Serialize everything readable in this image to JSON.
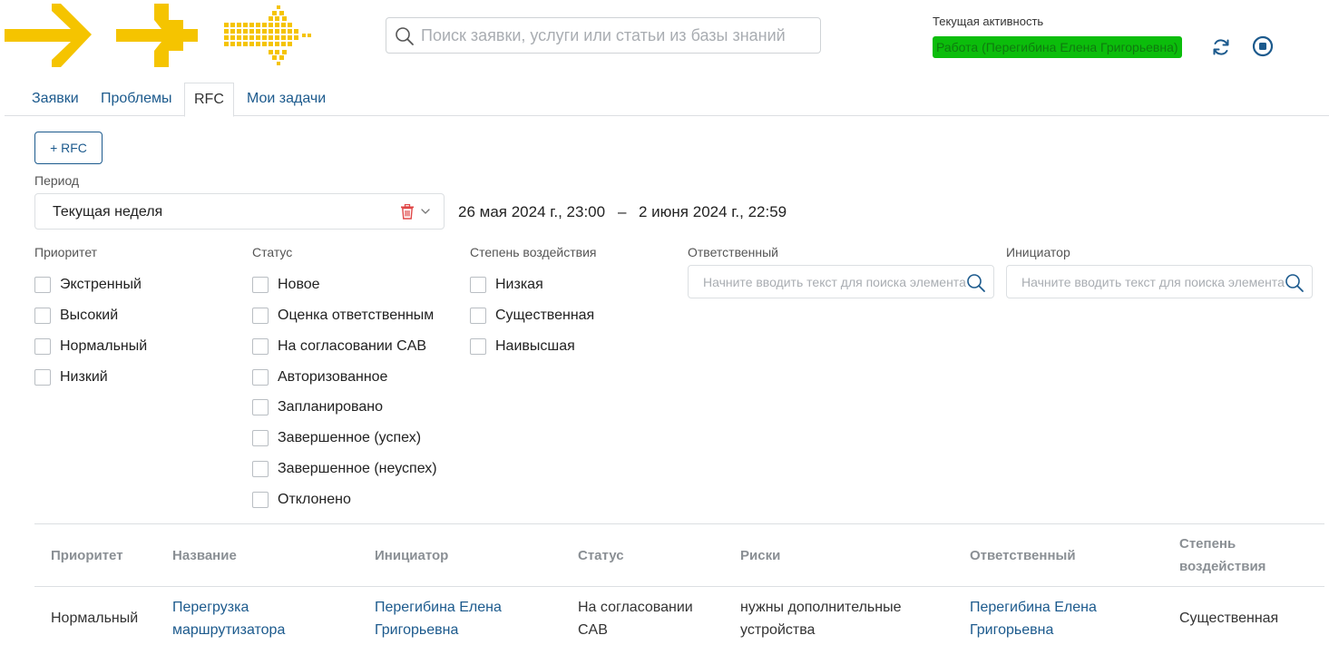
{
  "header": {
    "logo_icons": [
      "arrow-right-icon",
      "arrow-cross-icon",
      "dotted-arrow-icon"
    ],
    "search_placeholder": "Поиск заявки, услуги или статьи из базы знаний",
    "activity_label": "Текущая активность",
    "activity_value": "Работа (Перегибина Елена Григорьевна)",
    "activity_color": "#0bbd0b"
  },
  "tabs": [
    {
      "label": "Заявки"
    },
    {
      "label": "Проблемы"
    },
    {
      "label": "RFC",
      "active": true
    },
    {
      "label": "Мои задачи"
    }
  ],
  "toolbar": {
    "add_label": "+ RFC"
  },
  "period": {
    "label": "Период",
    "value": "Текущая неделя",
    "from": "26 мая 2024 г., 23:00",
    "separator": "–",
    "to": "2 июня 2024 г., 22:59"
  },
  "filters": {
    "priority": {
      "label": "Приоритет",
      "options": [
        "Экстренный",
        "Высокий",
        "Нормальный",
        "Низкий"
      ]
    },
    "status": {
      "label": "Статус",
      "options": [
        "Новое",
        "Оценка ответственным",
        "На согласовании CAB",
        "Авторизованное",
        "Запланировано",
        "Завершенное (успех)",
        "Завершенное (неуспех)",
        "Отклонено"
      ]
    },
    "impact": {
      "label": "Степень воздействия",
      "options": [
        "Низкая",
        "Существенная",
        "Наивысшая"
      ]
    },
    "responsible": {
      "label": "Ответственный",
      "placeholder": "Начните вводить текст для поиска элемента"
    },
    "initiator": {
      "label": "Инициатор",
      "placeholder": "Начните вводить текст для поиска элемента"
    }
  },
  "table": {
    "columns": {
      "priority": "Приоритет",
      "name": "Название",
      "initiator": "Инициатор",
      "status": "Статус",
      "risks": "Риски",
      "responsible": "Ответственный",
      "impact_1": "Степень",
      "impact_2": "воздействия"
    },
    "rows": [
      {
        "priority": "Нормальный",
        "name_1": "Перегрузка",
        "name_2": "маршрутизатора",
        "initiator_1": "Перегибина Елена",
        "initiator_2": "Григорьевна",
        "status_1": "На согласовании",
        "status_2": "CAB",
        "risks_1": "нужны дополнительные",
        "risks_2": "устройства",
        "responsible_1": "Перегибина Елена",
        "responsible_2": "Григорьевна",
        "impact": "Существенная"
      }
    ]
  },
  "colors": {
    "link": "#1c5a8d",
    "logo": "#f5c400",
    "danger": "#e04848"
  }
}
